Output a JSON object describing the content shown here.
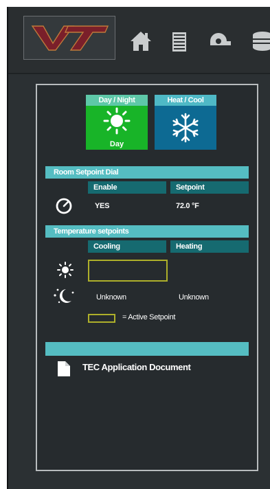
{
  "colors": {
    "background": "#2b3033",
    "panel": "#262b2e",
    "teal_bar": "#55bdc2",
    "dark_teal": "#166a70",
    "green_mode": "#18b428",
    "blue_mode": "#0d6a93",
    "logo_maroon": "#7a1f2a",
    "active_outline": "#aeb02a"
  },
  "header": {
    "logo_text": "VT",
    "nav_icons": [
      "home-icon",
      "building-icon",
      "fan-icon",
      "chiller-icon"
    ]
  },
  "mode_buttons": {
    "day_night": {
      "title": "Day / Night",
      "value": "Day",
      "icon": "sun-icon"
    },
    "heat_cool": {
      "title": "Heat / Cool",
      "icon": "snowflake-icon"
    }
  },
  "room_setpoint": {
    "section_title": "Room Setpoint Dial",
    "icon": "dial-icon",
    "headers": {
      "enable": "Enable",
      "setpoint": "Setpoint"
    },
    "enable_value": "YES",
    "setpoint_value": "72.0 °F"
  },
  "temperature_setpoints": {
    "section_title": "Temperature setpoints",
    "headers": {
      "cooling": "Cooling",
      "heating": "Heating"
    },
    "day_icon": "sun-icon",
    "night_icon": "moon-icon",
    "night_cooling": "Unknown",
    "night_heating": "Unknown",
    "legend": "= Active Setpoint"
  },
  "documents": {
    "link_label": "TEC Application Document",
    "icon": "document-icon"
  }
}
